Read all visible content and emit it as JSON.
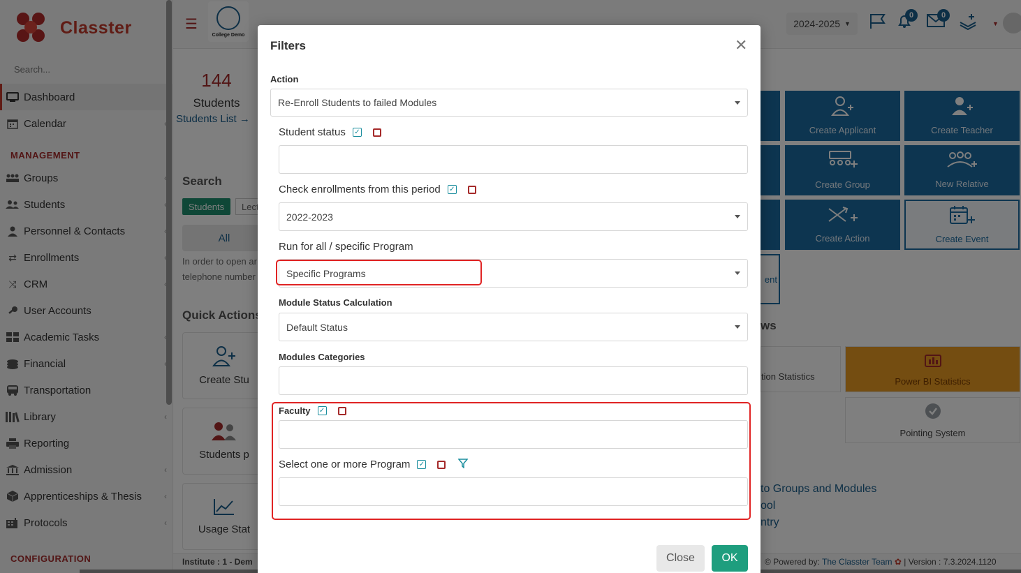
{
  "app": {
    "brand": "Classter",
    "college_logo_caption": "College Demo",
    "academic_year": "2024-2025",
    "notifications_count": "0",
    "messages_count": "0"
  },
  "sidebar": {
    "search_placeholder": "Search...",
    "items_top": [
      {
        "label": "Dashboard",
        "icon": "monitor-icon",
        "active": true
      },
      {
        "label": "Calendar",
        "icon": "calendar-icon"
      }
    ],
    "section_management": "MANAGEMENT",
    "items_management": [
      {
        "label": "Groups",
        "icon": "groups-icon"
      },
      {
        "label": "Students",
        "icon": "students-icon"
      },
      {
        "label": "Personnel & Contacts",
        "icon": "person-icon"
      },
      {
        "label": "Enrollments",
        "icon": "swap-arrows-icon"
      },
      {
        "label": "CRM",
        "icon": "shuffle-icon"
      },
      {
        "label": "User Accounts",
        "icon": "key-icon"
      },
      {
        "label": "Academic Tasks",
        "icon": "grid-icon"
      },
      {
        "label": "Financial",
        "icon": "coins-icon"
      },
      {
        "label": "Transportation",
        "icon": "bus-icon"
      },
      {
        "label": "Library",
        "icon": "books-icon"
      },
      {
        "label": "Reporting",
        "icon": "printer-icon"
      },
      {
        "label": "Admission",
        "icon": "building-icon"
      },
      {
        "label": "Apprenticeships & Thesis",
        "icon": "cube-icon"
      },
      {
        "label": "Protocols",
        "icon": "register-icon"
      }
    ],
    "section_configuration": "CONFIGURATION"
  },
  "background": {
    "student_count": "144",
    "student_label": "Students",
    "students_list_link": "Students List →",
    "search_heading": "Search",
    "tab_students": "Students",
    "tab_lect": "Lect",
    "btn_all": "All",
    "note_line1": "In order to open ar",
    "note_line2": "telephone number",
    "quick_actions_heading": "Quick Actions",
    "qa_cards": [
      "Create Stu",
      "Students p",
      "Usage Stat"
    ],
    "tiles": [
      {
        "label": "Create Applicant",
        "icon": "add-user-icon"
      },
      {
        "label": "Create Teacher",
        "icon": "add-teacher-icon"
      },
      {
        "label": "Create Group",
        "icon": "add-group-icon"
      },
      {
        "label": "New Relative",
        "icon": "relatives-icon"
      },
      {
        "label": "Create Action",
        "icon": "shuffle-plus-icon"
      },
      {
        "label": "Create Event",
        "icon": "calendar-plus-icon"
      }
    ],
    "tile_strip_text": "ent",
    "ws_heading": "ws",
    "cards": [
      {
        "label": "tion Statistics"
      },
      {
        "label": "Power BI Statistics"
      },
      {
        "label": "Pointing System"
      }
    ],
    "links": [
      "to Groups and Modules",
      "ool",
      "ntry"
    ],
    "footer_institute": "Institute : 1 - Dem",
    "footer_powered": "Powered by:",
    "footer_team": "The Classter Team",
    "footer_version": "| Version : 7.3.2024.1120"
  },
  "modal": {
    "title": "Filters",
    "action_label": "Action",
    "action_value": "Re-Enroll Students to failed Modules",
    "student_status_label": "Student status",
    "student_status_value": "",
    "period_label": "Check enrollments from this period",
    "period_value": "2022-2023",
    "program_scope_label": "Run for all / specific Program",
    "program_scope_value": "Specific Programs",
    "module_status_label": "Module Status Calculation",
    "module_status_value": "Default Status",
    "modules_categories_label": "Modules Categories",
    "modules_categories_value": "",
    "faculty_label": "Faculty",
    "faculty_value": "",
    "programs_label": "Select one or more Program",
    "programs_value": "",
    "close_button": "Close",
    "ok_button": "OK"
  },
  "colors": {
    "brand_red": "#c0392b",
    "primary_blue": "#1a6aa0",
    "ok_green": "#1e9e7e",
    "highlight_red": "#e02424"
  }
}
